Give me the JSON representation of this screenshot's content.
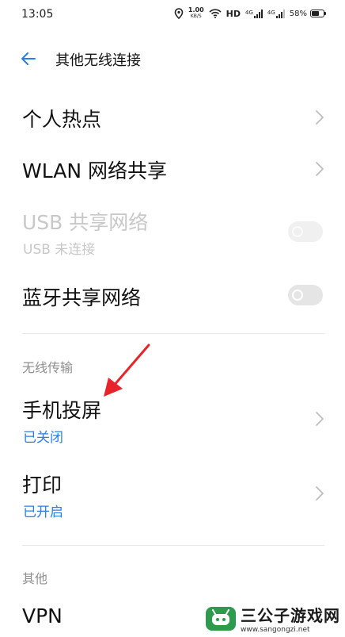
{
  "status_bar": {
    "time": "13:05",
    "speed_value": "1.00",
    "speed_unit": "KB/S",
    "hd_label": "HD",
    "net1": "4G",
    "net2": "4G",
    "battery": "58%"
  },
  "header": {
    "title": "其他无线连接"
  },
  "items": {
    "hotspot": {
      "label": "个人热点"
    },
    "wlan_share": {
      "label": "WLAN 网络共享"
    },
    "usb_share": {
      "label": "USB 共享网络",
      "sub": "USB 未连接"
    },
    "bt_share": {
      "label": "蓝牙共享网络"
    },
    "screen_cast": {
      "label": "手机投屏",
      "sub": "已关闭"
    },
    "print": {
      "label": "打印",
      "sub": "已开启"
    },
    "vpn": {
      "label": "VPN"
    }
  },
  "sections": {
    "wireless_transfer": "无线传输",
    "other": "其他"
  },
  "watermark": {
    "title": "三公子游戏网",
    "url": "www.sangongzi.net"
  },
  "colors": {
    "accent": "#2d7de8",
    "annotation_arrow": "#e8242a",
    "watermark_green": "#2e9a4e"
  }
}
